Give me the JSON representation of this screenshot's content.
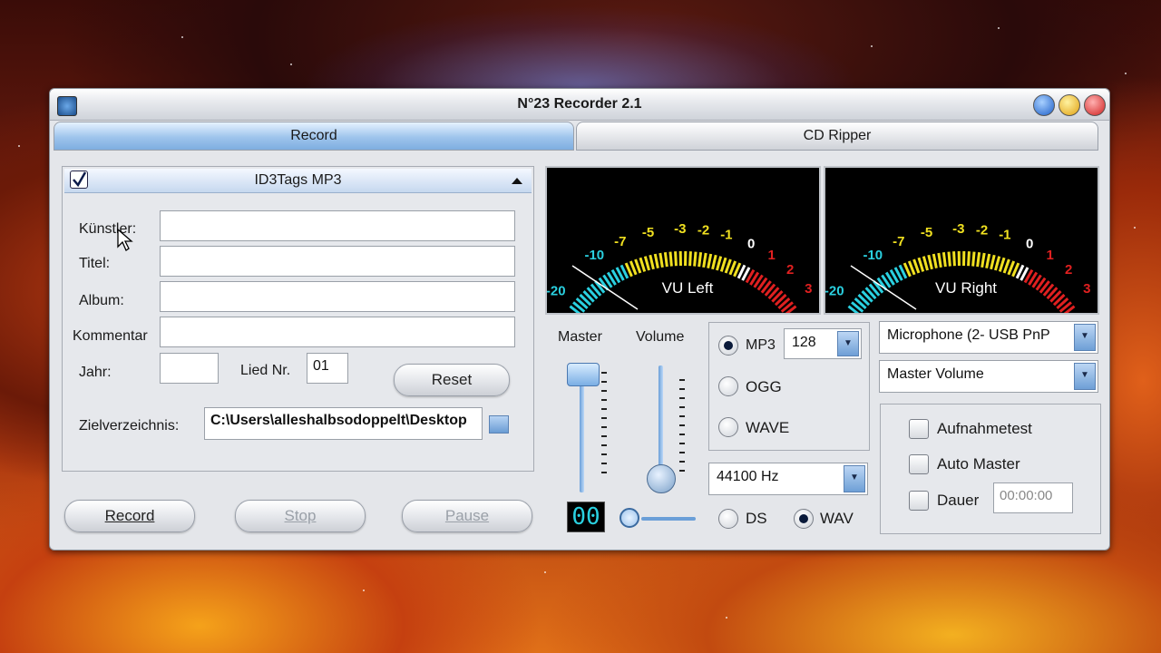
{
  "window": {
    "title": "N°23 Recorder 2.1"
  },
  "tabs": [
    {
      "label": "Record"
    },
    {
      "label": "CD Ripper"
    }
  ],
  "id3": {
    "header": "ID3Tags MP3",
    "fields": {
      "kuenstler_label": "Künstler:",
      "titel_label": "Titel:",
      "album_label": "Album:",
      "kommentar_label": "Kommentar",
      "jahr_label": "Jahr:",
      "lied_label": "Lied Nr.",
      "lied_value": "01",
      "reset_label": "Reset",
      "ziel_label": "Zielverzeichnis:",
      "ziel_value": "C:\\Users\\alleshalbsodoppelt\\Desktop"
    }
  },
  "controls": {
    "record": "Record",
    "stop": "Stop",
    "pause": "Pause"
  },
  "vu": {
    "left_label": "VU Left",
    "right_label": "VU Right",
    "scale": [
      "-20",
      "-10",
      "-7",
      "-5",
      "-3",
      "-2",
      "-1",
      "0",
      "1",
      "2",
      "3"
    ]
  },
  "mixer": {
    "master_label": "Master",
    "volume_label": "Volume",
    "counter": "00"
  },
  "format": {
    "mp3": "MP3",
    "ogg": "OGG",
    "wave": "WAVE",
    "bitrate": "128",
    "samplerate": "44100 Hz",
    "ds": "DS",
    "wav": "WAV"
  },
  "source": {
    "device": "Microphone (2- USB PnP",
    "mixer": "Master Volume"
  },
  "options": {
    "aufnahmetest": "Aufnahmetest",
    "auto_master": "Auto Master",
    "dauer": "Dauer",
    "dauer_value": "00:00:00"
  },
  "colors": {
    "accent": "#7eaee0",
    "vu_cyan": "#2ad0e0",
    "vu_yellow": "#f0e020",
    "vu_red": "#e02020"
  }
}
